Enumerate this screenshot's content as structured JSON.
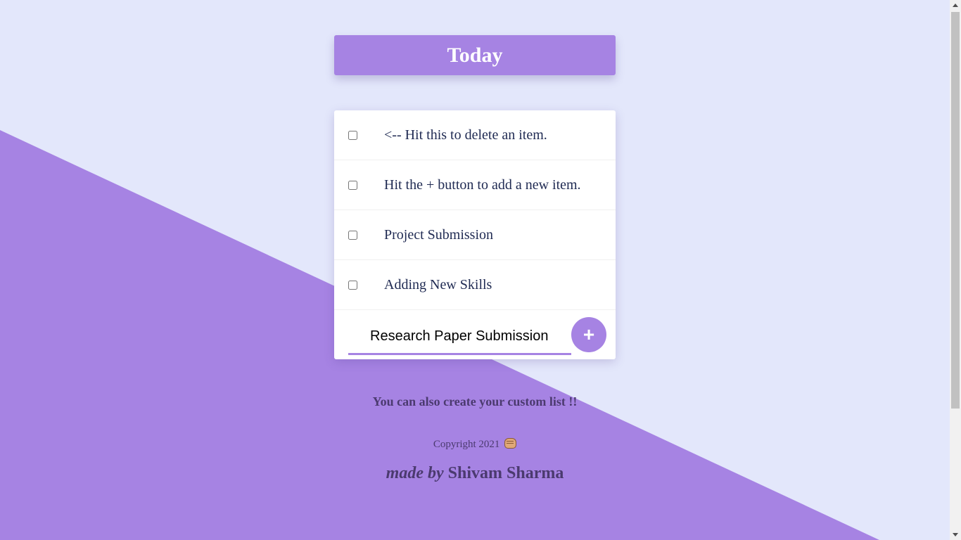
{
  "colors": {
    "background": "#e3e7fb",
    "accent": "#a683e3",
    "text_dark": "#1f2a52",
    "footer_text": "#4b3a6f"
  },
  "heading": {
    "title": "Today"
  },
  "list": {
    "items": [
      {
        "text": "<-- Hit this to delete an item.",
        "checked": false
      },
      {
        "text": "Hit the + button to add a new item.",
        "checked": false
      },
      {
        "text": "Project Submission",
        "checked": false
      },
      {
        "text": "Adding New Skills",
        "checked": false
      }
    ],
    "new_item": {
      "value": "Research Paper Submission",
      "add_label": "+"
    }
  },
  "footer": {
    "custom_note": "You can also create your custom list !!",
    "copyright": "Copyright 2021",
    "copyright_icon": "fist-bump-icon",
    "made_by_prefix": "made by",
    "author": "Shivam Sharma"
  }
}
